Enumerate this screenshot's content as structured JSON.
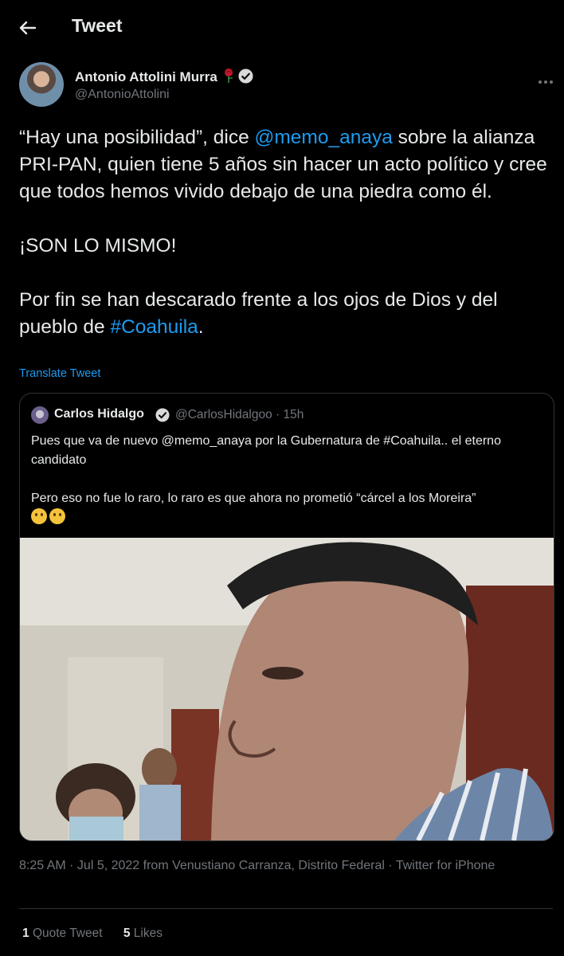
{
  "header": {
    "title": "Tweet"
  },
  "author": {
    "name": "Antonio Attolini Murra",
    "handle": "@AntonioAttolini"
  },
  "tweet": {
    "paragraph1_part1": "“Hay una posibilidad”, dice ",
    "mention": "@memo_anaya",
    "paragraph1_part2": " sobre la alianza PRI-PAN, quien tiene 5 años sin hacer un acto político y cree que todos hemos vivido debajo de una piedra como él.",
    "paragraph2": "¡SON LO MISMO!",
    "paragraph3_part1": "Por fin se han descarado frente a los ojos de Dios y del pueblo de ",
    "hashtag": "#Coahuila",
    "paragraph3_part2": ".",
    "translate_label": "Translate Tweet"
  },
  "quote": {
    "name": "Carlos Hidalgo",
    "meta": "@CarlosHidalgoo · 15h",
    "text1": "Pues que va de nuevo @memo_anaya por la Gubernatura de #Coahuila.. el eterno candidato",
    "text2": "Pero eso no fue lo raro, lo raro es que ahora no prometió “cárcel a los Moreira”"
  },
  "timestamp": "8:25 AM · Jul 5, 2022 from Venustiano Carranza, Distrito Federal · Twitter for iPhone",
  "stats": {
    "quote_count": "1",
    "quote_label": "Quote Tweet",
    "likes_count": "5",
    "likes_label": "Likes"
  },
  "colors": {
    "background": "#000000",
    "text": "#e7e9ea",
    "secondary": "#71767b",
    "accent": "#1d9bf0",
    "border": "#2f3336"
  },
  "icons": [
    "back-arrow-icon",
    "rose-icon",
    "verified-badge-icon",
    "more-icon",
    "thinking-emoji-icon",
    "shushing-emoji-icon"
  ]
}
